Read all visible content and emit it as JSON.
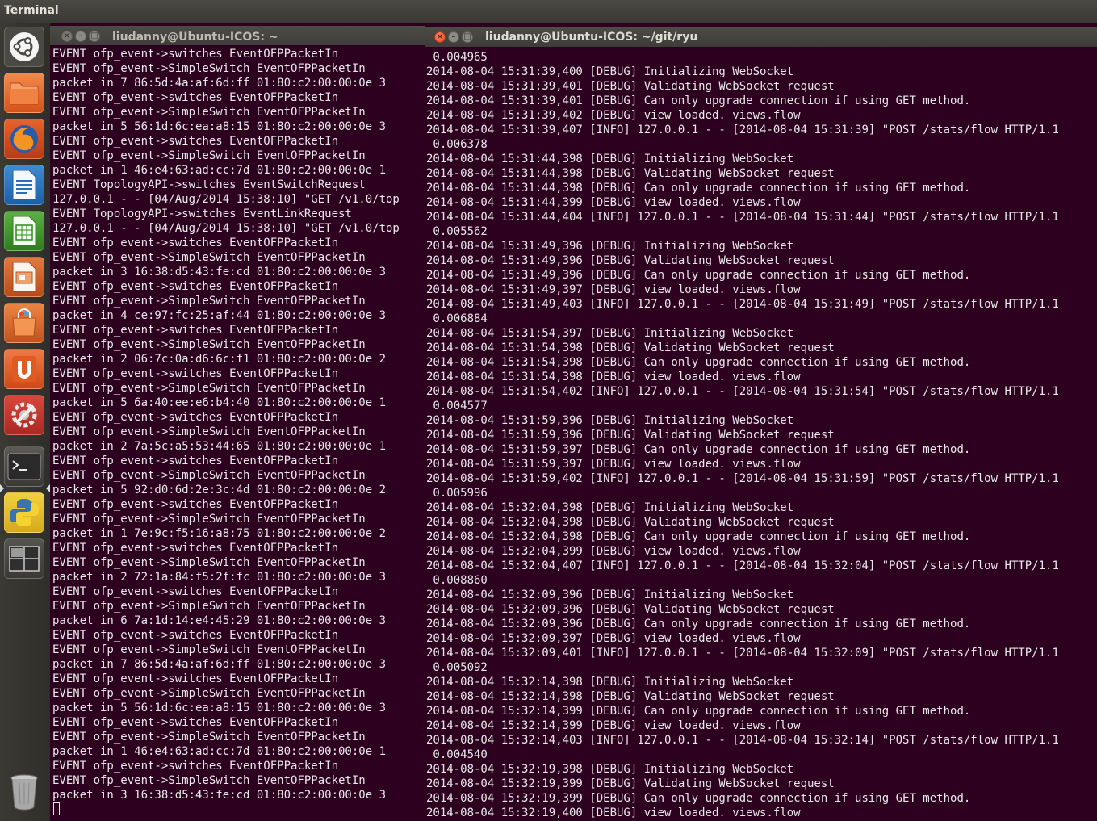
{
  "top_panel": {
    "app_title": "Terminal"
  },
  "launcher": {
    "items": [
      {
        "name": "dash-home",
        "icon": "ubuntu-logo-icon"
      },
      {
        "name": "files",
        "icon": "folder-icon"
      },
      {
        "name": "firefox",
        "icon": "firefox-icon"
      },
      {
        "name": "libreoffice-writer",
        "icon": "writer-icon"
      },
      {
        "name": "libreoffice-calc",
        "icon": "calc-icon"
      },
      {
        "name": "libreoffice-impress",
        "icon": "impress-icon"
      },
      {
        "name": "software-center",
        "icon": "shopping-bag-icon"
      },
      {
        "name": "ubuntu-one",
        "icon": "ubuntu-one-icon"
      },
      {
        "name": "system-settings",
        "icon": "settings-wrench-icon"
      },
      {
        "name": "terminal",
        "icon": "terminal-icon"
      },
      {
        "name": "python",
        "icon": "python-icon"
      },
      {
        "name": "workspace-switcher",
        "icon": "workspace-icon"
      },
      {
        "name": "trash",
        "icon": "trash-icon"
      }
    ]
  },
  "colors": {
    "terminal_bg": "#2c001e",
    "terminal_fg": "#e8e8e8",
    "close_active": "#df4a1e"
  },
  "left_window": {
    "title": "liudanny@Ubuntu-ICOS: ~",
    "lines": [
      "EVENT ofp_event->switches EventOFPPacketIn",
      "EVENT ofp_event->SimpleSwitch EventOFPPacketIn",
      "packet in 7 86:5d:4a:af:6d:ff 01:80:c2:00:00:0e 3",
      "EVENT ofp_event->switches EventOFPPacketIn",
      "EVENT ofp_event->SimpleSwitch EventOFPPacketIn",
      "packet in 5 56:1d:6c:ea:a8:15 01:80:c2:00:00:0e 3",
      "EVENT ofp_event->switches EventOFPPacketIn",
      "EVENT ofp_event->SimpleSwitch EventOFPPacketIn",
      "packet in 1 46:e4:63:ad:cc:7d 01:80:c2:00:00:0e 1",
      "EVENT TopologyAPI->switches EventSwitchRequest",
      "127.0.0.1 - - [04/Aug/2014 15:38:10] \"GET /v1.0/top",
      "EVENT TopologyAPI->switches EventLinkRequest",
      "127.0.0.1 - - [04/Aug/2014 15:38:10] \"GET /v1.0/top",
      "EVENT ofp_event->switches EventOFPPacketIn",
      "EVENT ofp_event->SimpleSwitch EventOFPPacketIn",
      "packet in 3 16:38:d5:43:fe:cd 01:80:c2:00:00:0e 3",
      "EVENT ofp_event->switches EventOFPPacketIn",
      "EVENT ofp_event->SimpleSwitch EventOFPPacketIn",
      "packet in 4 ce:97:fc:25:af:44 01:80:c2:00:00:0e 3",
      "EVENT ofp_event->switches EventOFPPacketIn",
      "EVENT ofp_event->SimpleSwitch EventOFPPacketIn",
      "packet in 2 06:7c:0a:d6:6c:f1 01:80:c2:00:00:0e 2",
      "EVENT ofp_event->switches EventOFPPacketIn",
      "EVENT ofp_event->SimpleSwitch EventOFPPacketIn",
      "packet in 5 6a:40:ee:e6:b4:40 01:80:c2:00:00:0e 1",
      "EVENT ofp_event->switches EventOFPPacketIn",
      "EVENT ofp_event->SimpleSwitch EventOFPPacketIn",
      "packet in 2 7a:5c:a5:53:44:65 01:80:c2:00:00:0e 1",
      "EVENT ofp_event->switches EventOFPPacketIn",
      "EVENT ofp_event->SimpleSwitch EventOFPPacketIn",
      "packet in 5 92:d0:6d:2e:3c:4d 01:80:c2:00:00:0e 2",
      "EVENT ofp_event->switches EventOFPPacketIn",
      "EVENT ofp_event->SimpleSwitch EventOFPPacketIn",
      "packet in 1 7e:9c:f5:16:a8:75 01:80:c2:00:00:0e 2",
      "EVENT ofp_event->switches EventOFPPacketIn",
      "EVENT ofp_event->SimpleSwitch EventOFPPacketIn",
      "packet in 2 72:1a:84:f5:2f:fc 01:80:c2:00:00:0e 3",
      "EVENT ofp_event->switches EventOFPPacketIn",
      "EVENT ofp_event->SimpleSwitch EventOFPPacketIn",
      "packet in 6 7a:1d:14:e4:45:29 01:80:c2:00:00:0e 3",
      "EVENT ofp_event->switches EventOFPPacketIn",
      "EVENT ofp_event->SimpleSwitch EventOFPPacketIn",
      "packet in 7 86:5d:4a:af:6d:ff 01:80:c2:00:00:0e 3",
      "EVENT ofp_event->switches EventOFPPacketIn",
      "EVENT ofp_event->SimpleSwitch EventOFPPacketIn",
      "packet in 5 56:1d:6c:ea:a8:15 01:80:c2:00:00:0e 3",
      "EVENT ofp_event->switches EventOFPPacketIn",
      "EVENT ofp_event->SimpleSwitch EventOFPPacketIn",
      "packet in 1 46:e4:63:ad:cc:7d 01:80:c2:00:00:0e 1",
      "EVENT ofp_event->switches EventOFPPacketIn",
      "EVENT ofp_event->SimpleSwitch EventOFPPacketIn",
      "packet in 3 16:38:d5:43:fe:cd 01:80:c2:00:00:0e 3",
      ""
    ]
  },
  "right_window": {
    "title": "liudanny@Ubuntu-ICOS: ~/git/ryu",
    "lines": [
      " 0.004965",
      "2014-08-04 15:31:39,400 [DEBUG] Initializing WebSocket",
      "2014-08-04 15:31:39,401 [DEBUG] Validating WebSocket request",
      "2014-08-04 15:31:39,401 [DEBUG] Can only upgrade connection if using GET method.",
      "2014-08-04 15:31:39,402 [DEBUG] view loaded. views.flow",
      "2014-08-04 15:31:39,407 [INFO] 127.0.0.1 - - [2014-08-04 15:31:39] \"POST /stats/flow HTTP/1.1",
      " 0.006378",
      "2014-08-04 15:31:44,398 [DEBUG] Initializing WebSocket",
      "2014-08-04 15:31:44,398 [DEBUG] Validating WebSocket request",
      "2014-08-04 15:31:44,398 [DEBUG] Can only upgrade connection if using GET method.",
      "2014-08-04 15:31:44,399 [DEBUG] view loaded. views.flow",
      "2014-08-04 15:31:44,404 [INFO] 127.0.0.1 - - [2014-08-04 15:31:44] \"POST /stats/flow HTTP/1.1",
      " 0.005562",
      "2014-08-04 15:31:49,396 [DEBUG] Initializing WebSocket",
      "2014-08-04 15:31:49,396 [DEBUG] Validating WebSocket request",
      "2014-08-04 15:31:49,396 [DEBUG] Can only upgrade connection if using GET method.",
      "2014-08-04 15:31:49,397 [DEBUG] view loaded. views.flow",
      "2014-08-04 15:31:49,403 [INFO] 127.0.0.1 - - [2014-08-04 15:31:49] \"POST /stats/flow HTTP/1.1",
      " 0.006884",
      "2014-08-04 15:31:54,397 [DEBUG] Initializing WebSocket",
      "2014-08-04 15:31:54,398 [DEBUG] Validating WebSocket request",
      "2014-08-04 15:31:54,398 [DEBUG] Can only upgrade connection if using GET method.",
      "2014-08-04 15:31:54,398 [DEBUG] view loaded. views.flow",
      "2014-08-04 15:31:54,402 [INFO] 127.0.0.1 - - [2014-08-04 15:31:54] \"POST /stats/flow HTTP/1.1",
      " 0.004577",
      "2014-08-04 15:31:59,396 [DEBUG] Initializing WebSocket",
      "2014-08-04 15:31:59,396 [DEBUG] Validating WebSocket request",
      "2014-08-04 15:31:59,397 [DEBUG] Can only upgrade connection if using GET method.",
      "2014-08-04 15:31:59,397 [DEBUG] view loaded. views.flow",
      "2014-08-04 15:31:59,402 [INFO] 127.0.0.1 - - [2014-08-04 15:31:59] \"POST /stats/flow HTTP/1.1",
      " 0.005996",
      "2014-08-04 15:32:04,398 [DEBUG] Initializing WebSocket",
      "2014-08-04 15:32:04,398 [DEBUG] Validating WebSocket request",
      "2014-08-04 15:32:04,398 [DEBUG] Can only upgrade connection if using GET method.",
      "2014-08-04 15:32:04,399 [DEBUG] view loaded. views.flow",
      "2014-08-04 15:32:04,407 [INFO] 127.0.0.1 - - [2014-08-04 15:32:04] \"POST /stats/flow HTTP/1.1",
      " 0.008860",
      "2014-08-04 15:32:09,396 [DEBUG] Initializing WebSocket",
      "2014-08-04 15:32:09,396 [DEBUG] Validating WebSocket request",
      "2014-08-04 15:32:09,396 [DEBUG] Can only upgrade connection if using GET method.",
      "2014-08-04 15:32:09,397 [DEBUG] view loaded. views.flow",
      "2014-08-04 15:32:09,401 [INFO] 127.0.0.1 - - [2014-08-04 15:32:09] \"POST /stats/flow HTTP/1.1",
      " 0.005092",
      "2014-08-04 15:32:14,398 [DEBUG] Initializing WebSocket",
      "2014-08-04 15:32:14,398 [DEBUG] Validating WebSocket request",
      "2014-08-04 15:32:14,399 [DEBUG] Can only upgrade connection if using GET method.",
      "2014-08-04 15:32:14,399 [DEBUG] view loaded. views.flow",
      "2014-08-04 15:32:14,403 [INFO] 127.0.0.1 - - [2014-08-04 15:32:14] \"POST /stats/flow HTTP/1.1",
      " 0.004540",
      "2014-08-04 15:32:19,398 [DEBUG] Initializing WebSocket",
      "2014-08-04 15:32:19,399 [DEBUG] Validating WebSocket request",
      "2014-08-04 15:32:19,399 [DEBUG] Can only upgrade connection if using GET method.",
      "2014-08-04 15:32:19,400 [DEBUG] view loaded. views.flow"
    ]
  }
}
